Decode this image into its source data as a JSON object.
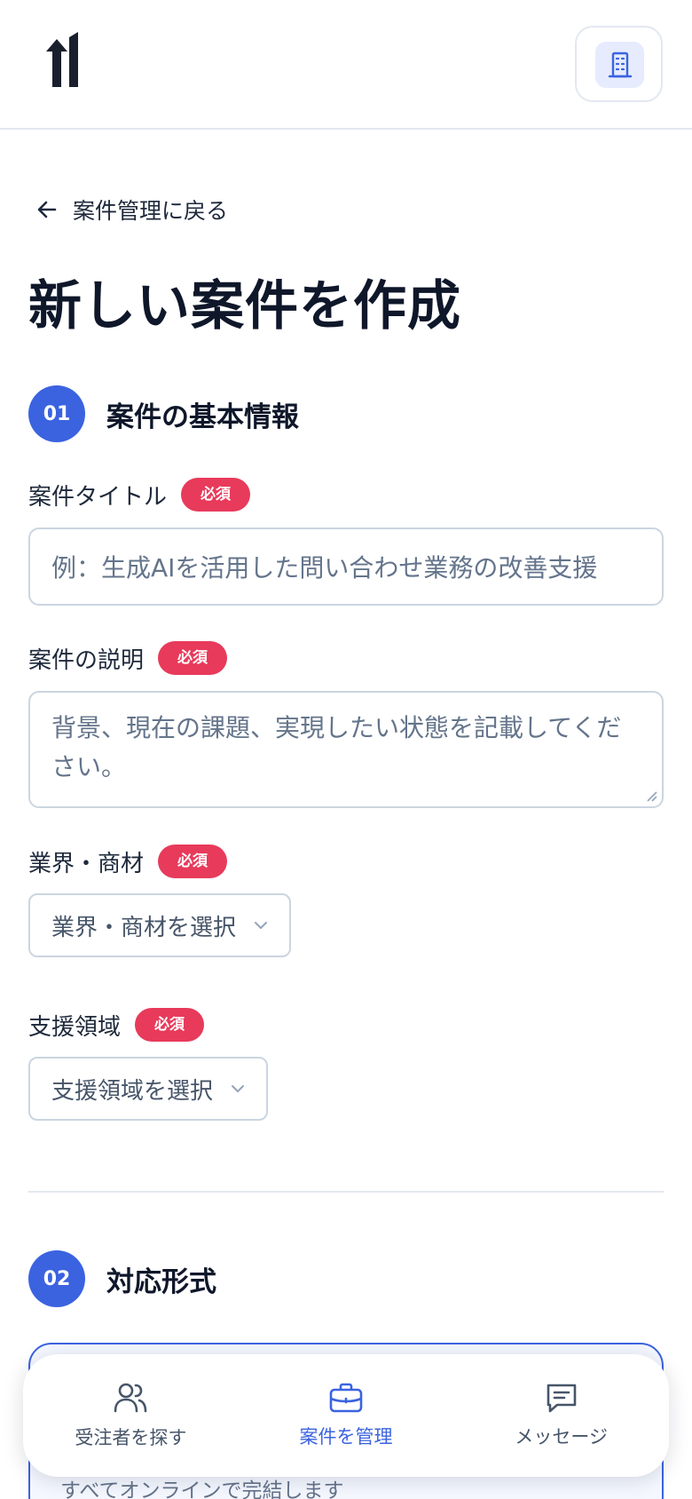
{
  "header": {
    "logo_icon": "logo-icon",
    "company_icon": "building-icon"
  },
  "back_link": {
    "label": "案件管理に戻る",
    "icon": "arrow-left-icon"
  },
  "page_title": "新しい案件を作成",
  "section1": {
    "number": "01",
    "title": "案件の基本情報",
    "title_field": {
      "label": "案件タイトル",
      "required": "必須",
      "placeholder": "例：生成AIを活用した問い合わせ業務の改善支援"
    },
    "description_field": {
      "label": "案件の説明",
      "required": "必須",
      "placeholder": "背景、現在の課題、実現したい状態を記載してください。"
    },
    "industry_field": {
      "label": "業界・商材",
      "required": "必須",
      "selected": "業界・商材を選択"
    },
    "support_field": {
      "label": "支援領域",
      "required": "必須",
      "selected": "支援領域を選択"
    }
  },
  "section2": {
    "number": "02",
    "title": "対応形式",
    "card_desc": "すべてオンラインで完結します"
  },
  "bottom_nav": {
    "items": [
      {
        "label": "受注者を探す",
        "icon": "users-icon",
        "active": false
      },
      {
        "label": "案件を管理",
        "icon": "briefcase-icon",
        "active": true
      },
      {
        "label": "メッセージ",
        "icon": "message-icon",
        "active": false
      }
    ]
  },
  "colors": {
    "accent": "#3b63e0",
    "required_badge": "#e83a5b",
    "text": "#0f172a",
    "muted": "#64748b",
    "border": "#cbd5e1"
  }
}
